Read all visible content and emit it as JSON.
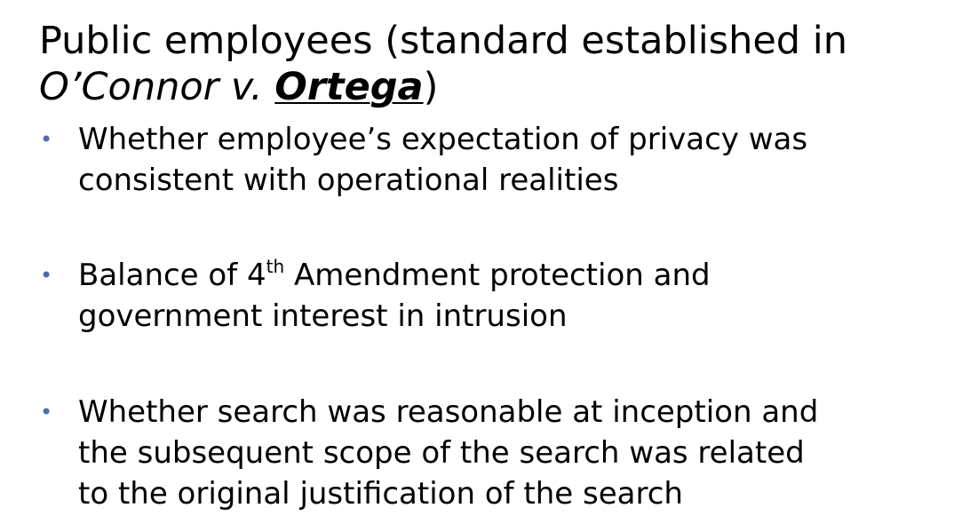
{
  "slide": {
    "title": {
      "part1": "Public employees (standard established in",
      "case_party_1": "O’Connor v.",
      "case_party_2": "Ortega",
      "closing": ")"
    },
    "bullet_color": "#4a6fa5",
    "bullet_glyph": "•",
    "bullets": [
      {
        "line1": "Whether employee’s expectation of privacy was",
        "line2": "consistent with operational realities"
      },
      {
        "line1_pre": "Balance of 4",
        "line1_sup": "th",
        "line1_post": " Amendment protection and",
        "line2": "government interest in intrusion"
      },
      {
        "line1": "Whether search was reasonable at inception and",
        "line2": "the subsequent scope of the search was related",
        "line3": "to the original justification of the search"
      }
    ]
  }
}
